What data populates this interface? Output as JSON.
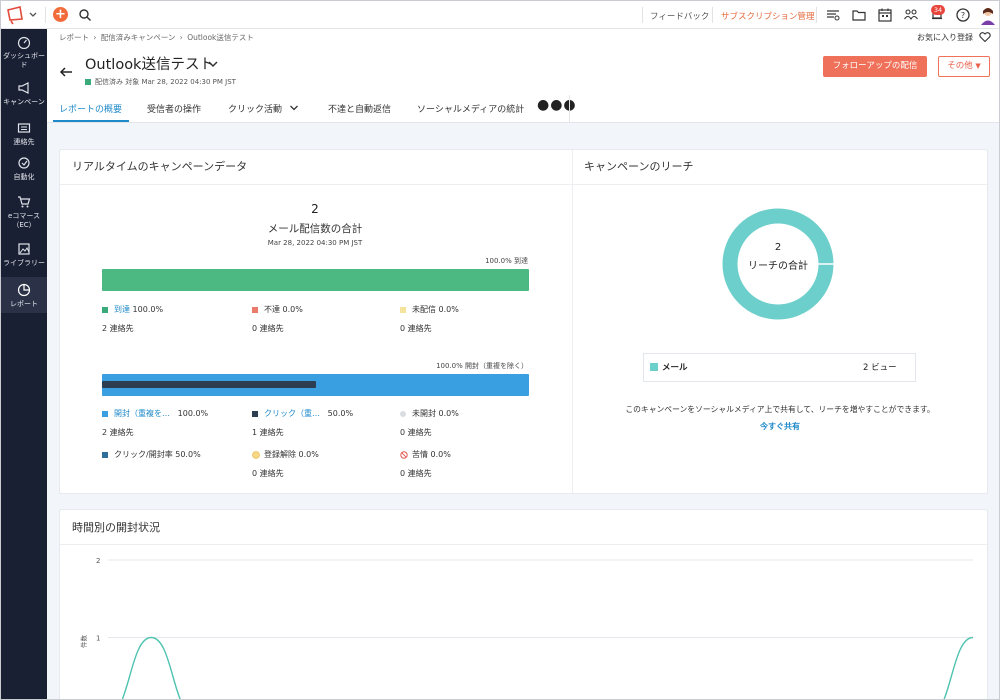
{
  "topbar": {
    "feedback": "フィードバック",
    "subscription": "サブスクリプション管理",
    "badge_count": "34"
  },
  "sidebar": {
    "items": [
      {
        "label": "ダッシュボード",
        "icon": "dashboard-icon"
      },
      {
        "label": "キャンペーン",
        "icon": "megaphone-icon"
      },
      {
        "label": "連絡先",
        "icon": "contacts-icon"
      },
      {
        "label": "自動化",
        "icon": "automation-icon"
      },
      {
        "label": "eコマース（EC）",
        "icon": "cart-icon"
      },
      {
        "label": "ライブラリー",
        "icon": "library-icon"
      },
      {
        "label": "レポート",
        "icon": "report-icon"
      }
    ]
  },
  "breadcrumb": [
    "レポート",
    "配信済みキャンペーン",
    "Outlook送信テスト"
  ],
  "favorite_label": "お気に入り登録",
  "campaign": {
    "title": "Outlook送信テスト",
    "status": "配信済み",
    "sent_on": "対象 Mar 28, 2022 04:30 PM JST"
  },
  "buttons": {
    "follow_up": "フォローアップの配信",
    "other": "その他"
  },
  "tabs": [
    "レポートの概要",
    "受信者の操作",
    "クリック活動",
    "不達と自動返信",
    "ソーシャルメディアの統計"
  ],
  "realtime": {
    "title": "リアルタイムのキャンペーンデータ",
    "total_value": "2",
    "total_label": "メール配信数の合計",
    "date": "Mar 28, 2022 04:30 PM JST",
    "delivered_bar_label": "100.0% 到達",
    "delivered_pct": 1.0,
    "delivery_legend": [
      {
        "name": "到達",
        "pct": "100.0%",
        "sub": "2 連絡先",
        "color": "#3aaa7a",
        "link": true
      },
      {
        "name": "不達",
        "pct": "0.0%",
        "sub": "0 連絡先",
        "color": "#ea7b6a",
        "link": false
      },
      {
        "name": "未配信",
        "pct": "0.0%",
        "sub": "0 連絡先",
        "color": "#f4e39a",
        "link": false
      }
    ],
    "open_bar_label": "100.0% 開封（重複を除く）",
    "open_pct": 1.0,
    "click_pct": 0.5,
    "open_legend": [
      {
        "name": "開封（重複を…",
        "pct": "100.0%",
        "sub": "2 連絡先",
        "color": "#3a9fe0",
        "link": true,
        "icon": "square"
      },
      {
        "name": "クリック（重…",
        "pct": "50.0%",
        "sub": "1 連絡先",
        "color": "#2d3e50",
        "link": true,
        "icon": "square"
      },
      {
        "name": "未開封",
        "pct": "0.0%",
        "sub": "0 連絡先",
        "color": "#d9dde2",
        "link": false,
        "icon": "circle"
      },
      {
        "name": "クリック/開封率",
        "pct": "50.0%",
        "sub": "",
        "color": "#2f6f99",
        "link": false,
        "icon": "square"
      },
      {
        "name": "登録解除",
        "pct": "0.0%",
        "sub": "0 連絡先",
        "color": "#f2b84b",
        "link": false,
        "icon": "smiley"
      },
      {
        "name": "苦情",
        "pct": "0.0%",
        "sub": "0 連絡先",
        "color": "#e35a4f",
        "link": false,
        "icon": "ban"
      }
    ]
  },
  "reach": {
    "title": "キャンペーンのリーチ",
    "total_value": "2",
    "total_label": "リーチの合計",
    "ring_color": "#6dcfcb",
    "row_label": "メール",
    "row_value": "2 ビュー",
    "share_text": "このキャンペーンをソーシャルメディア上で共有して、リーチを増やすことができます。",
    "share_link": "今すぐ共有"
  },
  "timeline": {
    "title": "時間別の開封状況",
    "ylabel": "件数"
  },
  "chart_data": {
    "type": "line",
    "title": "時間別の開封状況",
    "xlabel": "",
    "ylabel": "件数",
    "ylim": [
      0,
      2
    ],
    "yticks": [
      2,
      1
    ],
    "series": [
      {
        "values": [
          0,
          1,
          0,
          0,
          0,
          0,
          0,
          0,
          0,
          0,
          0,
          0,
          0,
          0,
          0,
          0,
          0,
          0,
          0,
          0,
          1
        ]
      }
    ],
    "grid": true,
    "line_color": "#4fc3b0"
  }
}
